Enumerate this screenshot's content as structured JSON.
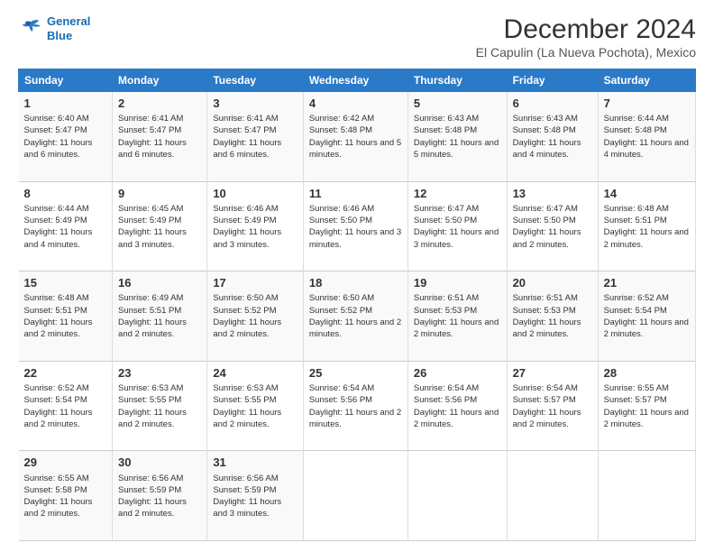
{
  "logo": {
    "line1": "General",
    "line2": "Blue"
  },
  "title": "December 2024",
  "subtitle": "El Capulin (La Nueva Pochota), Mexico",
  "headers": [
    "Sunday",
    "Monday",
    "Tuesday",
    "Wednesday",
    "Thursday",
    "Friday",
    "Saturday"
  ],
  "weeks": [
    [
      {
        "day": "1",
        "rise": "6:40 AM",
        "set": "5:47 PM",
        "daylight": "11 hours and 6 minutes."
      },
      {
        "day": "2",
        "rise": "6:41 AM",
        "set": "5:47 PM",
        "daylight": "11 hours and 6 minutes."
      },
      {
        "day": "3",
        "rise": "6:41 AM",
        "set": "5:47 PM",
        "daylight": "11 hours and 6 minutes."
      },
      {
        "day": "4",
        "rise": "6:42 AM",
        "set": "5:48 PM",
        "daylight": "11 hours and 5 minutes."
      },
      {
        "day": "5",
        "rise": "6:43 AM",
        "set": "5:48 PM",
        "daylight": "11 hours and 5 minutes."
      },
      {
        "day": "6",
        "rise": "6:43 AM",
        "set": "5:48 PM",
        "daylight": "11 hours and 4 minutes."
      },
      {
        "day": "7",
        "rise": "6:44 AM",
        "set": "5:48 PM",
        "daylight": "11 hours and 4 minutes."
      }
    ],
    [
      {
        "day": "8",
        "rise": "6:44 AM",
        "set": "5:49 PM",
        "daylight": "11 hours and 4 minutes."
      },
      {
        "day": "9",
        "rise": "6:45 AM",
        "set": "5:49 PM",
        "daylight": "11 hours and 3 minutes."
      },
      {
        "day": "10",
        "rise": "6:46 AM",
        "set": "5:49 PM",
        "daylight": "11 hours and 3 minutes."
      },
      {
        "day": "11",
        "rise": "6:46 AM",
        "set": "5:50 PM",
        "daylight": "11 hours and 3 minutes."
      },
      {
        "day": "12",
        "rise": "6:47 AM",
        "set": "5:50 PM",
        "daylight": "11 hours and 3 minutes."
      },
      {
        "day": "13",
        "rise": "6:47 AM",
        "set": "5:50 PM",
        "daylight": "11 hours and 2 minutes."
      },
      {
        "day": "14",
        "rise": "6:48 AM",
        "set": "5:51 PM",
        "daylight": "11 hours and 2 minutes."
      }
    ],
    [
      {
        "day": "15",
        "rise": "6:48 AM",
        "set": "5:51 PM",
        "daylight": "11 hours and 2 minutes."
      },
      {
        "day": "16",
        "rise": "6:49 AM",
        "set": "5:51 PM",
        "daylight": "11 hours and 2 minutes."
      },
      {
        "day": "17",
        "rise": "6:50 AM",
        "set": "5:52 PM",
        "daylight": "11 hours and 2 minutes."
      },
      {
        "day": "18",
        "rise": "6:50 AM",
        "set": "5:52 PM",
        "daylight": "11 hours and 2 minutes."
      },
      {
        "day": "19",
        "rise": "6:51 AM",
        "set": "5:53 PM",
        "daylight": "11 hours and 2 minutes."
      },
      {
        "day": "20",
        "rise": "6:51 AM",
        "set": "5:53 PM",
        "daylight": "11 hours and 2 minutes."
      },
      {
        "day": "21",
        "rise": "6:52 AM",
        "set": "5:54 PM",
        "daylight": "11 hours and 2 minutes."
      }
    ],
    [
      {
        "day": "22",
        "rise": "6:52 AM",
        "set": "5:54 PM",
        "daylight": "11 hours and 2 minutes."
      },
      {
        "day": "23",
        "rise": "6:53 AM",
        "set": "5:55 PM",
        "daylight": "11 hours and 2 minutes."
      },
      {
        "day": "24",
        "rise": "6:53 AM",
        "set": "5:55 PM",
        "daylight": "11 hours and 2 minutes."
      },
      {
        "day": "25",
        "rise": "6:54 AM",
        "set": "5:56 PM",
        "daylight": "11 hours and 2 minutes."
      },
      {
        "day": "26",
        "rise": "6:54 AM",
        "set": "5:56 PM",
        "daylight": "11 hours and 2 minutes."
      },
      {
        "day": "27",
        "rise": "6:54 AM",
        "set": "5:57 PM",
        "daylight": "11 hours and 2 minutes."
      },
      {
        "day": "28",
        "rise": "6:55 AM",
        "set": "5:57 PM",
        "daylight": "11 hours and 2 minutes."
      }
    ],
    [
      {
        "day": "29",
        "rise": "6:55 AM",
        "set": "5:58 PM",
        "daylight": "11 hours and 2 minutes."
      },
      {
        "day": "30",
        "rise": "6:56 AM",
        "set": "5:59 PM",
        "daylight": "11 hours and 2 minutes."
      },
      {
        "day": "31",
        "rise": "6:56 AM",
        "set": "5:59 PM",
        "daylight": "11 hours and 3 minutes."
      },
      null,
      null,
      null,
      null
    ]
  ],
  "labels": {
    "sunrise": "Sunrise:",
    "sunset": "Sunset:",
    "daylight": "Daylight:"
  }
}
